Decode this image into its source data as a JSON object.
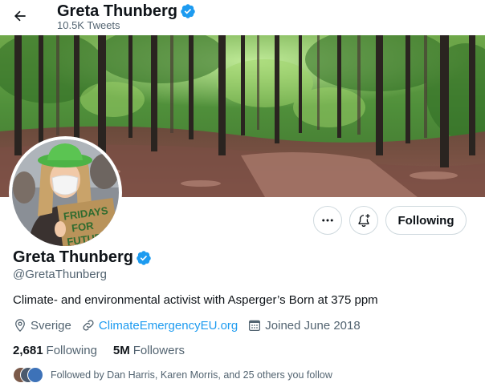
{
  "header": {
    "title": "Greta Thunberg",
    "tweet_count": "10.5K Tweets"
  },
  "profile": {
    "name": "Greta Thunberg",
    "handle": "@GretaThunberg",
    "bio": "Climate- and environmental activist with Asperger’s Born at 375 ppm",
    "location": "Sverige",
    "website": "ClimateEmergencyEU.org",
    "joined": "Joined June 2018",
    "avatar_sign_text": "FRIDAYS FOR FUTURE"
  },
  "actions": {
    "following_label": "Following"
  },
  "stats": {
    "following_count": "2,681",
    "following_label": "Following",
    "followers_count": "5M",
    "followers_label": "Followers"
  },
  "followed_by": {
    "text": "Followed by Dan Harris, Karen Morris, and 25 others you follow"
  },
  "icons": {
    "back": "arrow-left-icon",
    "verified": "verified-badge-icon",
    "more": "more-dots-icon",
    "notify": "bell-plus-icon",
    "location": "location-pin-icon",
    "link": "link-icon",
    "calendar": "calendar-icon"
  },
  "colors": {
    "accent": "#1d9bf0",
    "text_primary": "#0f1419",
    "text_secondary": "#536471",
    "border": "#cfd9de"
  }
}
